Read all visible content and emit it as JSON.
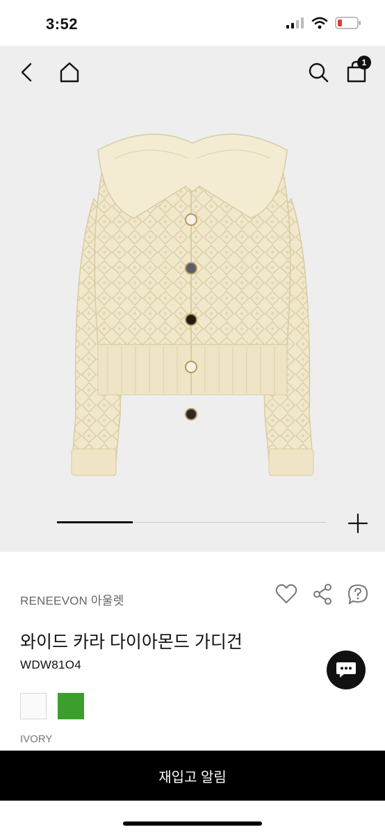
{
  "status": {
    "time": "3:52"
  },
  "nav": {
    "cart_count": "1"
  },
  "gallery": {
    "progress": 0.28
  },
  "product": {
    "brand": "RENEEVON 아울렛",
    "name": "와이드 카라 다이아몬드 가디건",
    "code": "WDW81O4",
    "selected_color": "IVORY",
    "swatches": [
      {
        "name": "IVORY",
        "color": "#fafafa"
      },
      {
        "name": "GREEN",
        "color": "#3c9f2d"
      }
    ]
  },
  "cta": {
    "label": "재입고 알림"
  },
  "colors": {
    "background_hero": "#eeeeee",
    "cta": "#000000",
    "garment": "#f1e8cc"
  }
}
